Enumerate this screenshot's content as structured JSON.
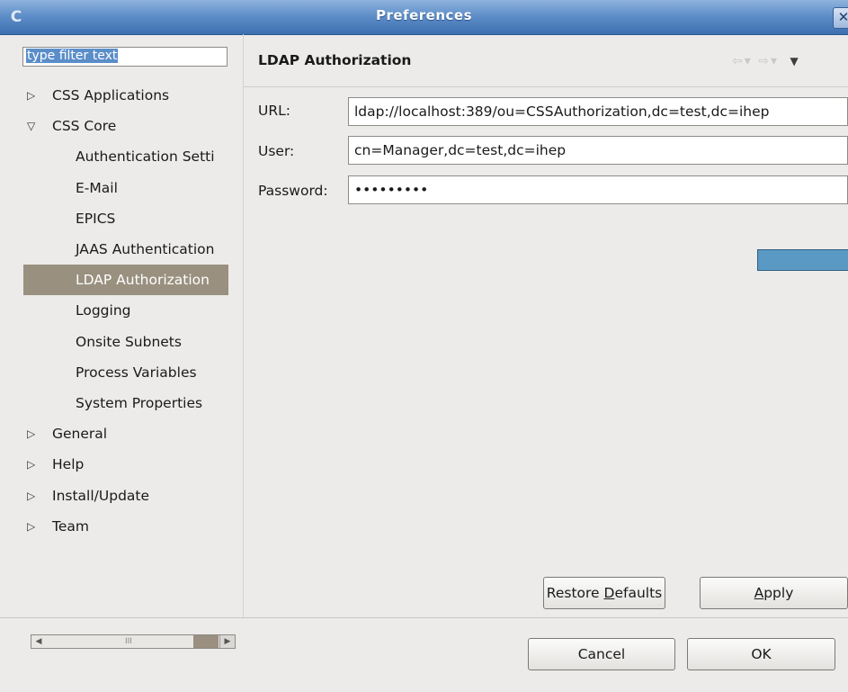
{
  "window": {
    "title": "Preferences",
    "icon": "eclipse-app-icon",
    "close_glyph": "✕"
  },
  "sidebar": {
    "filter": {
      "value": "type filter text",
      "selected": true
    },
    "items": [
      {
        "label": "CSS Applications",
        "level": 0,
        "expander": "collapsed"
      },
      {
        "label": "CSS Core",
        "level": 0,
        "expander": "expanded"
      },
      {
        "label": "Authentication Setti",
        "level": 1
      },
      {
        "label": "E-Mail",
        "level": 1
      },
      {
        "label": "EPICS",
        "level": 1
      },
      {
        "label": "JAAS Authentication",
        "level": 1
      },
      {
        "label": "LDAP Authorization",
        "level": 1,
        "selected": true
      },
      {
        "label": "Logging",
        "level": 1
      },
      {
        "label": "Onsite Subnets",
        "level": 1
      },
      {
        "label": "Process Variables",
        "level": 1
      },
      {
        "label": "System Properties",
        "level": 1
      },
      {
        "label": "General",
        "level": 0,
        "expander": "collapsed"
      },
      {
        "label": "Help",
        "level": 0,
        "expander": "collapsed"
      },
      {
        "label": "Install/Update",
        "level": 0,
        "expander": "collapsed"
      },
      {
        "label": "Team",
        "level": 0,
        "expander": "collapsed"
      }
    ],
    "scrollbar": {
      "grip": "III"
    }
  },
  "page": {
    "title": "LDAP Authorization",
    "nav": {
      "back": "⇦▾",
      "forward": "⇨▾",
      "menu": "▼"
    },
    "fields": [
      {
        "label": "URL:",
        "value": "ldap://localhost:389/ou=CSSAuthorization,dc=test,dc=ihep"
      },
      {
        "label": "User:",
        "value": "cn=Manager,dc=test,dc=ihep"
      },
      {
        "label": "Password:",
        "value": "•••••••••"
      }
    ],
    "accent_color": "#5a99c4",
    "buttons": {
      "restore_defaults": {
        "pre": "Restore ",
        "mnemonic": "D",
        "post": "efaults"
      },
      "apply": {
        "pre": "",
        "mnemonic": "A",
        "post": "pply"
      }
    }
  },
  "dialog_buttons": {
    "cancel": "Cancel",
    "ok": "OK"
  }
}
